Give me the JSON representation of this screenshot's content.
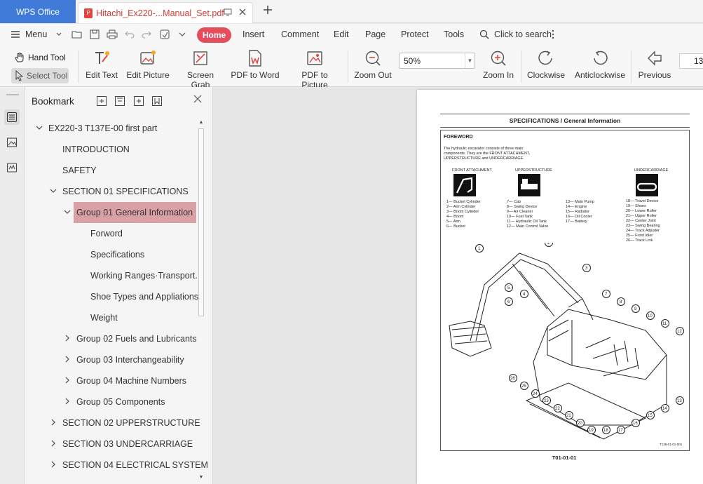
{
  "titlebar": {
    "app_tab": "WPS Office",
    "doc_tab": "Hitachi_Ex220-...Manual_Set.pdf",
    "pdf_badge": "P"
  },
  "menubar": {
    "menu_label": "Menu",
    "tabs": [
      "Home",
      "Insert",
      "Comment",
      "Edit",
      "Page",
      "Protect",
      "Tools"
    ],
    "search_label": "Click to search"
  },
  "ribbon": {
    "hand_tool": "Hand Tool",
    "select_tool": "Select Tool",
    "edit_text": "Edit Text",
    "edit_picture": "Edit Picture",
    "screen_grab": "Screen Grab",
    "pdf_to_word": "PDF to Word",
    "pdf_to_picture": "PDF to Picture",
    "zoom_out": "Zoom Out",
    "zoom_value": "50%",
    "zoom_in": "Zoom In",
    "clockwise": "Clockwise",
    "anticlockwise": "Anticlockwise",
    "previous": "Previous",
    "page_number": "13"
  },
  "bookmark": {
    "title": "Bookmark",
    "items": [
      {
        "label": "EX220-3 T137E-00 first part",
        "level": 0,
        "chevron": "down"
      },
      {
        "label": "INTRODUCTION",
        "level": 1,
        "chevron": ""
      },
      {
        "label": "SAFETY",
        "level": 1,
        "chevron": ""
      },
      {
        "label": "SECTION 01 SPECIFICATIONS",
        "level": 1,
        "chevron": "down"
      },
      {
        "label": "Group 01 General Information",
        "level": 2,
        "chevron": "down",
        "selected": true
      },
      {
        "label": "Forword",
        "level": 3,
        "chevron": ""
      },
      {
        "label": "Specifications",
        "level": 3,
        "chevron": ""
      },
      {
        "label": "Working Ranges·Transport...",
        "level": 3,
        "chevron": ""
      },
      {
        "label": "Shoe Types and Appliations",
        "level": 3,
        "chevron": ""
      },
      {
        "label": "Weight",
        "level": 3,
        "chevron": ""
      },
      {
        "label": "Group 02 Fuels and Lubricants",
        "level": 2,
        "chevron": "right"
      },
      {
        "label": "Group 03 Interchangeability",
        "level": 2,
        "chevron": "right"
      },
      {
        "label": "Group 04 Machine Numbers",
        "level": 2,
        "chevron": "right"
      },
      {
        "label": "Group 05 Components",
        "level": 2,
        "chevron": "right"
      },
      {
        "label": "SECTION 02 UPPERSTRUCTURE",
        "level": 1,
        "chevron": "right"
      },
      {
        "label": "SECTION 03 UNDERCARRIAGE",
        "level": 1,
        "chevron": "right"
      },
      {
        "label": "SECTION 04 ELECTRICAL SYSTEM",
        "level": 1,
        "chevron": "right"
      }
    ]
  },
  "document": {
    "header": "SPECIFICATIONS / General Information",
    "foreword_title": "FOREWORD",
    "foreword_text": [
      "The hydraulic excavator consists of three main",
      "components. They are the FRONT ATTACHMENT,",
      "UPPERSTRUCTURE and UNDERCARRIAGE."
    ],
    "col_front": "FRONT ATTACHMENT",
    "col_upper": "UPPERSTRUCTURE",
    "col_under": "UNDERCARRIAGE",
    "list_front": [
      "1— Bucket Cylinder",
      "2— Arm Cylinder",
      "3— Boom Cylinder",
      "4— Boom",
      "5— Arm",
      "6— Bucket"
    ],
    "list_upper": [
      "7— Cab",
      "8— Swing Device",
      "9— Air Cleaner",
      "10— Fuel Tank",
      "11— Hydraulic Oil Tank",
      "12— Main Control Valve"
    ],
    "list_upper2": [
      "13— Main Pump",
      "14— Engine",
      "15— Radiator",
      "16— Oil Cooler",
      "17— Battery"
    ],
    "list_under": [
      "18— Travel Device",
      "19— Shoes",
      "20— Lower Roller",
      "21— Upper Roller",
      "22— Center Joint",
      "23— Swing Bearing",
      "24— Track Adjuster",
      "25— Front Idler",
      "26— Track Link"
    ],
    "figure_code": "T138-01-01-001",
    "footer": "T01-01-01"
  }
}
